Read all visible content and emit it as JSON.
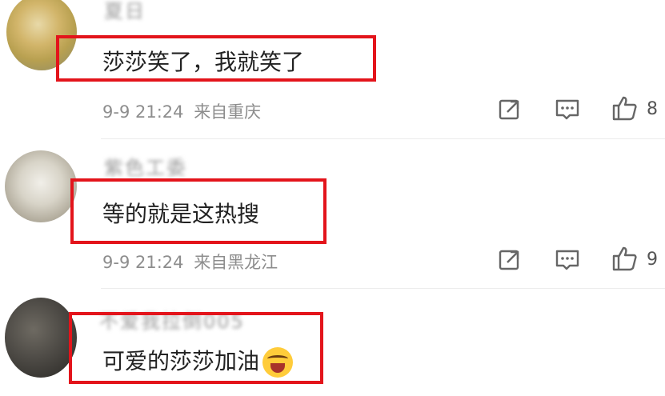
{
  "comments": [
    {
      "username": "夏日",
      "text": "莎莎笑了，我就笑了",
      "time": "9-9 21:24",
      "location": "来自重庆",
      "likes": "8"
    },
    {
      "username": "紫色工委",
      "text": "等的就是这热搜",
      "time": "9-9 21:24",
      "location": "来自黑龙江",
      "likes": "9"
    },
    {
      "username": "不爱我拉倒005",
      "text": "可爱的莎莎加油",
      "emoji": "laughing-crying-emoji"
    }
  ],
  "icons": {
    "share": "share-icon",
    "comment": "comment-icon",
    "like": "thumbs-up-icon"
  },
  "colors": {
    "highlight_border": "#e3141b",
    "meta_text": "#8d8d8d",
    "main_text": "#222222"
  }
}
